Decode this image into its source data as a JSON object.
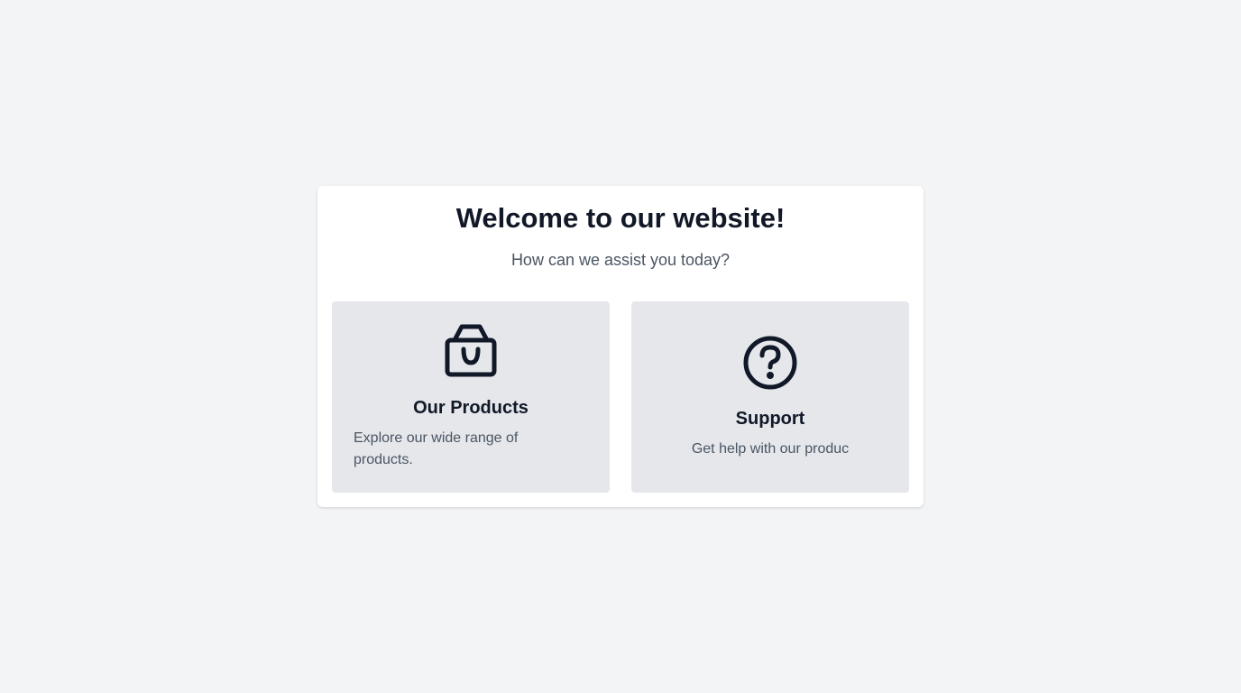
{
  "header": {
    "title": "Welcome to our website!",
    "subtitle": "How can we assist you today?"
  },
  "options": [
    {
      "icon": "shopping-bag-icon",
      "title": "Our Products",
      "description": "Explore our wide range of products."
    },
    {
      "icon": "question-circle-icon",
      "title": "Support",
      "description": "Get help with our produc"
    }
  ],
  "colors": {
    "page_background": "#f3f4f6",
    "card_background": "#ffffff",
    "tile_background": "#e5e7eb",
    "heading_text": "#111827",
    "body_text": "#4b5563"
  }
}
